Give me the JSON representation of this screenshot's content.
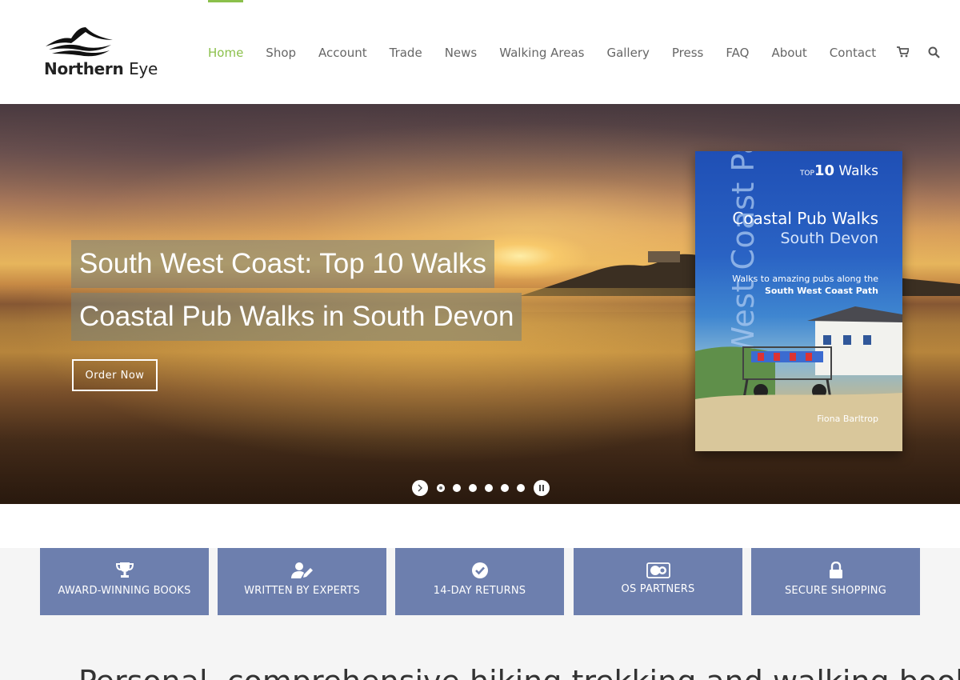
{
  "brand": {
    "logo_bold": "Northern",
    "logo_light": "Eye"
  },
  "nav": {
    "items": [
      {
        "label": "Home",
        "active": true
      },
      {
        "label": "Shop"
      },
      {
        "label": "Account"
      },
      {
        "label": "Trade"
      },
      {
        "label": "News"
      },
      {
        "label": "Walking Areas"
      },
      {
        "label": "Gallery"
      },
      {
        "label": "Press"
      },
      {
        "label": "FAQ"
      },
      {
        "label": "About"
      },
      {
        "label": "Contact"
      }
    ],
    "accent_color": "#8bc04b",
    "icons": [
      "cart-icon",
      "search-icon"
    ]
  },
  "hero": {
    "title_line1": "South West Coast: Top 10 Walks",
    "title_line2": "Coastal Pub Walks in South Devon",
    "cta_label": "Order Now",
    "slide_count": 6,
    "active_slide": 1
  },
  "book": {
    "spine": "South West Coast Path",
    "series_prefix": "TOP",
    "series_number": "10",
    "series_word": "Walks",
    "title": "Coastal Pub Walks",
    "subtitle": "South Devon",
    "tagline_start": "Walks to amazing pubs along the",
    "tagline_bold": "South West Coast Path",
    "author": "Fiona Barltrop"
  },
  "features": {
    "color": "#6d7fae",
    "items": [
      {
        "label": "AWARD-WINNING BOOKS",
        "icon": "trophy-icon"
      },
      {
        "label": "WRITTEN BY EXPERTS",
        "icon": "user-edit-icon"
      },
      {
        "label": "14-DAY RETURNS",
        "icon": "check-circle-icon"
      },
      {
        "label": "OS PARTNERS",
        "icon": "os-logo-icon"
      },
      {
        "label": "SECURE SHOPPING",
        "icon": "lock-icon"
      }
    ]
  },
  "intro": {
    "partial_text": "Personal, comprehensive hiking trekking and walking books"
  }
}
